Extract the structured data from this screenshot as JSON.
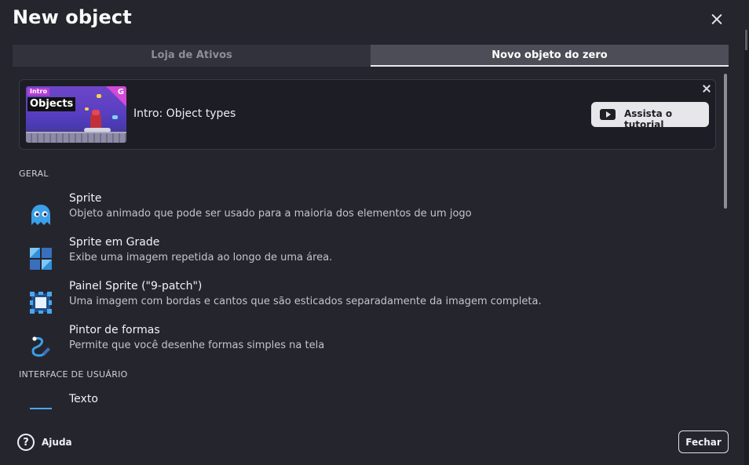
{
  "dialog": {
    "title": "New object"
  },
  "tabs": [
    {
      "label": "Loja de Ativos",
      "active": false
    },
    {
      "label": "Novo objeto do zero",
      "active": true
    }
  ],
  "tutorial": {
    "thumbnail": {
      "tag_small": "Intro",
      "tag_large": "Objects"
    },
    "label": "Intro: Object types",
    "button_label": "Assista o tutorial"
  },
  "sections": [
    {
      "title": "GERAL",
      "items": [
        {
          "name": "Sprite",
          "description": "Objeto animado que pode ser usado para a maioria dos elementos de um jogo",
          "icon": "ghost-icon"
        },
        {
          "name": "Sprite em Grade",
          "description": "Exibe uma imagem repetida ao longo de uma área.",
          "icon": "tiled-sprite-icon"
        },
        {
          "name": "Painel Sprite (\"9-patch\")",
          "description": "Uma imagem com bordas e cantos que são esticados separadamente da imagem completa.",
          "icon": "nine-patch-icon"
        },
        {
          "name": "Pintor de formas",
          "description": "Permite que você desenhe formas simples na tela",
          "icon": "shape-painter-icon"
        }
      ]
    },
    {
      "title": "INTERFACE DE USUÁRIO",
      "items": [
        {
          "name": "Texto",
          "description": "",
          "icon": "text-object-icon"
        }
      ]
    }
  ],
  "footer": {
    "help_label": "Ajuda",
    "close_label": "Fechar"
  },
  "colors": {
    "background": "#25252e",
    "active_tab": "#4d4d58",
    "inactive_tab": "#32323c",
    "accent_blue": "#2b8fd9"
  }
}
